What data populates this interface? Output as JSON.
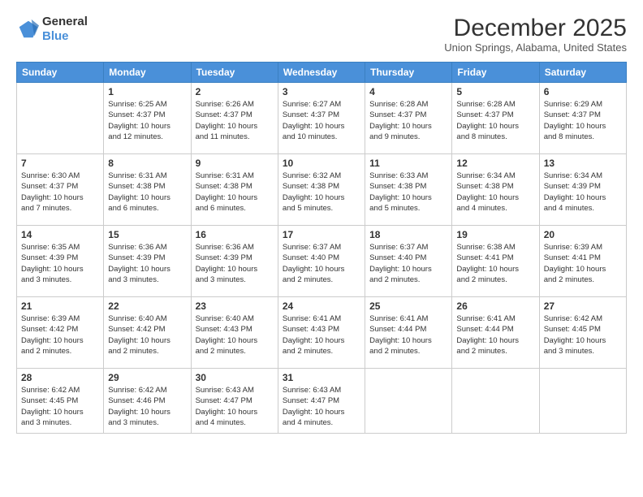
{
  "logo": {
    "line1": "General",
    "line2": "Blue"
  },
  "title": "December 2025",
  "subtitle": "Union Springs, Alabama, United States",
  "header_days": [
    "Sunday",
    "Monday",
    "Tuesday",
    "Wednesday",
    "Thursday",
    "Friday",
    "Saturday"
  ],
  "weeks": [
    [
      {
        "day": "",
        "info": ""
      },
      {
        "day": "1",
        "info": "Sunrise: 6:25 AM\nSunset: 4:37 PM\nDaylight: 10 hours\nand 12 minutes."
      },
      {
        "day": "2",
        "info": "Sunrise: 6:26 AM\nSunset: 4:37 PM\nDaylight: 10 hours\nand 11 minutes."
      },
      {
        "day": "3",
        "info": "Sunrise: 6:27 AM\nSunset: 4:37 PM\nDaylight: 10 hours\nand 10 minutes."
      },
      {
        "day": "4",
        "info": "Sunrise: 6:28 AM\nSunset: 4:37 PM\nDaylight: 10 hours\nand 9 minutes."
      },
      {
        "day": "5",
        "info": "Sunrise: 6:28 AM\nSunset: 4:37 PM\nDaylight: 10 hours\nand 8 minutes."
      },
      {
        "day": "6",
        "info": "Sunrise: 6:29 AM\nSunset: 4:37 PM\nDaylight: 10 hours\nand 8 minutes."
      }
    ],
    [
      {
        "day": "7",
        "info": "Sunrise: 6:30 AM\nSunset: 4:37 PM\nDaylight: 10 hours\nand 7 minutes."
      },
      {
        "day": "8",
        "info": "Sunrise: 6:31 AM\nSunset: 4:38 PM\nDaylight: 10 hours\nand 6 minutes."
      },
      {
        "day": "9",
        "info": "Sunrise: 6:31 AM\nSunset: 4:38 PM\nDaylight: 10 hours\nand 6 minutes."
      },
      {
        "day": "10",
        "info": "Sunrise: 6:32 AM\nSunset: 4:38 PM\nDaylight: 10 hours\nand 5 minutes."
      },
      {
        "day": "11",
        "info": "Sunrise: 6:33 AM\nSunset: 4:38 PM\nDaylight: 10 hours\nand 5 minutes."
      },
      {
        "day": "12",
        "info": "Sunrise: 6:34 AM\nSunset: 4:38 PM\nDaylight: 10 hours\nand 4 minutes."
      },
      {
        "day": "13",
        "info": "Sunrise: 6:34 AM\nSunset: 4:39 PM\nDaylight: 10 hours\nand 4 minutes."
      }
    ],
    [
      {
        "day": "14",
        "info": "Sunrise: 6:35 AM\nSunset: 4:39 PM\nDaylight: 10 hours\nand 3 minutes."
      },
      {
        "day": "15",
        "info": "Sunrise: 6:36 AM\nSunset: 4:39 PM\nDaylight: 10 hours\nand 3 minutes."
      },
      {
        "day": "16",
        "info": "Sunrise: 6:36 AM\nSunset: 4:39 PM\nDaylight: 10 hours\nand 3 minutes."
      },
      {
        "day": "17",
        "info": "Sunrise: 6:37 AM\nSunset: 4:40 PM\nDaylight: 10 hours\nand 2 minutes."
      },
      {
        "day": "18",
        "info": "Sunrise: 6:37 AM\nSunset: 4:40 PM\nDaylight: 10 hours\nand 2 minutes."
      },
      {
        "day": "19",
        "info": "Sunrise: 6:38 AM\nSunset: 4:41 PM\nDaylight: 10 hours\nand 2 minutes."
      },
      {
        "day": "20",
        "info": "Sunrise: 6:39 AM\nSunset: 4:41 PM\nDaylight: 10 hours\nand 2 minutes."
      }
    ],
    [
      {
        "day": "21",
        "info": "Sunrise: 6:39 AM\nSunset: 4:42 PM\nDaylight: 10 hours\nand 2 minutes."
      },
      {
        "day": "22",
        "info": "Sunrise: 6:40 AM\nSunset: 4:42 PM\nDaylight: 10 hours\nand 2 minutes."
      },
      {
        "day": "23",
        "info": "Sunrise: 6:40 AM\nSunset: 4:43 PM\nDaylight: 10 hours\nand 2 minutes."
      },
      {
        "day": "24",
        "info": "Sunrise: 6:41 AM\nSunset: 4:43 PM\nDaylight: 10 hours\nand 2 minutes."
      },
      {
        "day": "25",
        "info": "Sunrise: 6:41 AM\nSunset: 4:44 PM\nDaylight: 10 hours\nand 2 minutes."
      },
      {
        "day": "26",
        "info": "Sunrise: 6:41 AM\nSunset: 4:44 PM\nDaylight: 10 hours\nand 2 minutes."
      },
      {
        "day": "27",
        "info": "Sunrise: 6:42 AM\nSunset: 4:45 PM\nDaylight: 10 hours\nand 3 minutes."
      }
    ],
    [
      {
        "day": "28",
        "info": "Sunrise: 6:42 AM\nSunset: 4:45 PM\nDaylight: 10 hours\nand 3 minutes."
      },
      {
        "day": "29",
        "info": "Sunrise: 6:42 AM\nSunset: 4:46 PM\nDaylight: 10 hours\nand 3 minutes."
      },
      {
        "day": "30",
        "info": "Sunrise: 6:43 AM\nSunset: 4:47 PM\nDaylight: 10 hours\nand 4 minutes."
      },
      {
        "day": "31",
        "info": "Sunrise: 6:43 AM\nSunset: 4:47 PM\nDaylight: 10 hours\nand 4 minutes."
      },
      {
        "day": "",
        "info": ""
      },
      {
        "day": "",
        "info": ""
      },
      {
        "day": "",
        "info": ""
      }
    ]
  ]
}
